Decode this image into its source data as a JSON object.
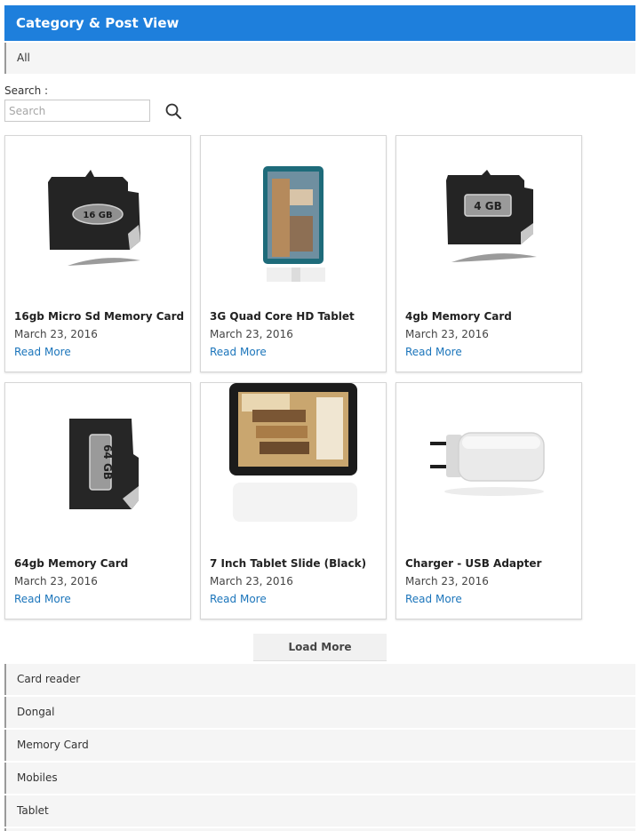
{
  "header": {
    "title": "Category & Post View"
  },
  "top_category": {
    "label": "All"
  },
  "search": {
    "label": "Search :",
    "placeholder": "Search"
  },
  "posts": [
    {
      "title": "16gb Micro Sd Memory Card",
      "date": "March 23, 2016",
      "link": "Read More",
      "image_label": "16 GB"
    },
    {
      "title": "3G Quad Core HD Tablet",
      "date": "March 23, 2016",
      "link": "Read More"
    },
    {
      "title": "4gb Memory Card",
      "date": "March 23, 2016",
      "link": "Read More",
      "image_label": "4 GB"
    },
    {
      "title": "64gb Memory Card",
      "date": "March 23, 2016",
      "link": "Read More",
      "image_label": "64 GB"
    },
    {
      "title": "7 Inch Tablet Slide (Black)",
      "date": "March 23, 2016",
      "link": "Read More"
    },
    {
      "title": "Charger - USB Adapter",
      "date": "March 23, 2016",
      "link": "Read More"
    }
  ],
  "load_more": {
    "label": "Load More"
  },
  "categories": [
    {
      "label": "Card reader"
    },
    {
      "label": "Dongal"
    },
    {
      "label": "Memory Card"
    },
    {
      "label": "Mobiles"
    },
    {
      "label": "Tablet"
    }
  ],
  "colors": {
    "header_bg": "#1e7fdc",
    "link": "#1b75bb"
  }
}
